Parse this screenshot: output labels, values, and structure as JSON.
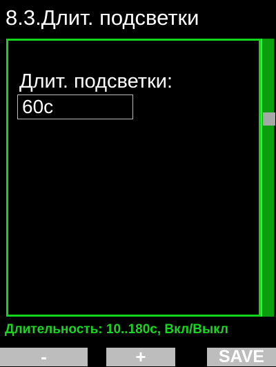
{
  "header": {
    "title": "8.3.Длит. подсветки"
  },
  "setting": {
    "label": "Длит. подсветки:",
    "value": "60с"
  },
  "scrollbar": {
    "position_fraction": 0.3
  },
  "footer": {
    "help_text": "Длительность: 10..180с, Вкл/Выкл"
  },
  "softkeys": {
    "minus_label": "-",
    "plus_label": "+",
    "save_label": "SAVE"
  },
  "colors": {
    "accent_green": "#12d61a",
    "scrollbar_green": "#0b9f10",
    "softkey_gray": "#bdbdbd"
  }
}
